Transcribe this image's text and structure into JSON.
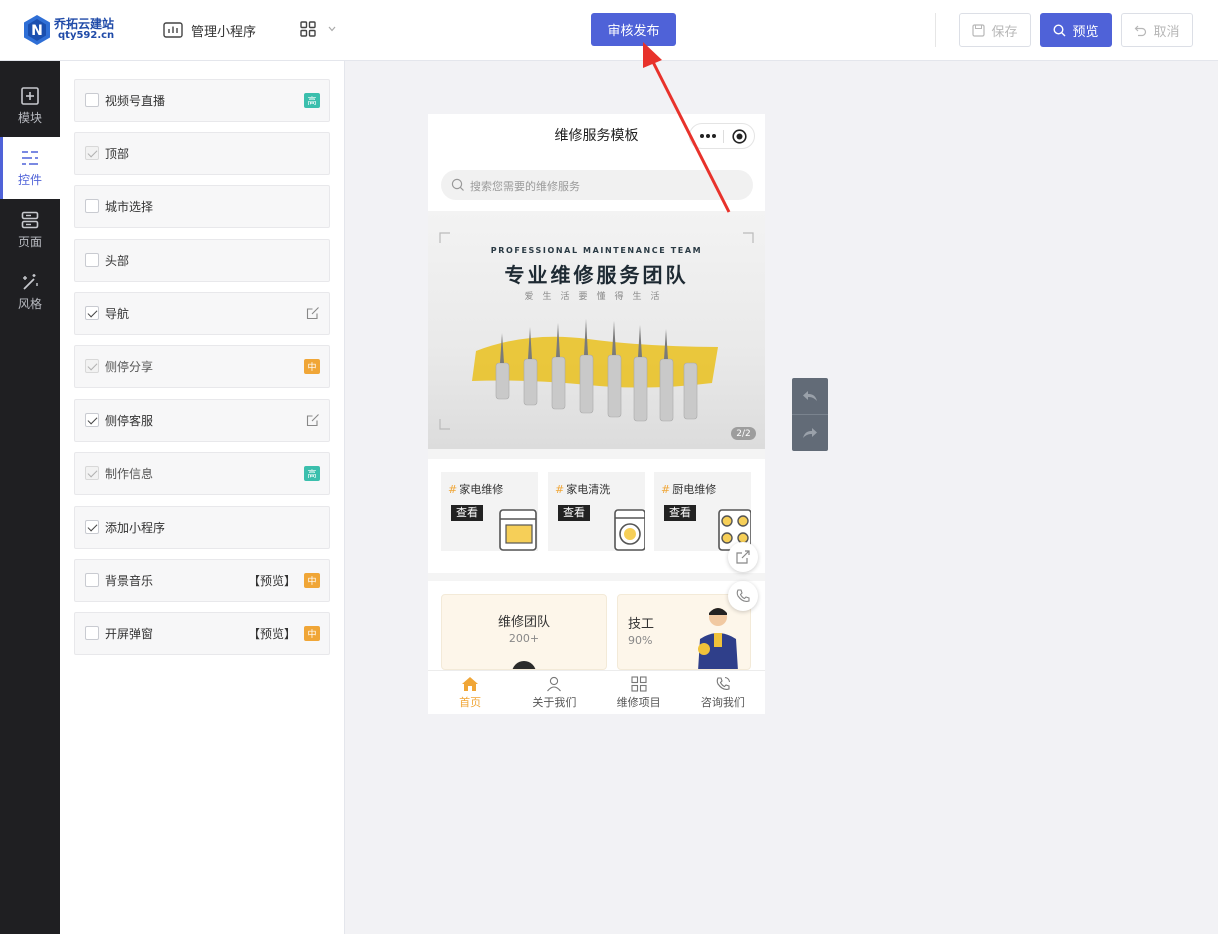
{
  "header": {
    "logo_name": "乔拓云建站",
    "logo_url": "qty592.cn",
    "manage_label": "管理小程序",
    "publish_label": "审核发布",
    "save_label": "保存",
    "preview_label": "预览",
    "cancel_label": "取消"
  },
  "leftnav": {
    "items": [
      {
        "label": "模块",
        "icon": "plus-square-icon"
      },
      {
        "label": "控件",
        "icon": "sliders-icon"
      },
      {
        "label": "页面",
        "icon": "server-icon"
      },
      {
        "label": "风格",
        "icon": "magic-wand-icon"
      }
    ],
    "active_index": 1
  },
  "controls": [
    {
      "label": "视频号直播",
      "checked": false,
      "disabled": false,
      "tag": "高"
    },
    {
      "label": "顶部",
      "checked": true,
      "disabled": true
    },
    {
      "label": "城市选择",
      "checked": false,
      "disabled": false
    },
    {
      "label": "头部",
      "checked": false,
      "disabled": false
    },
    {
      "label": "导航",
      "checked": true,
      "disabled": false,
      "editable": true
    },
    {
      "label": "侧停分享",
      "checked": true,
      "disabled": true,
      "tag": "中"
    },
    {
      "label": "侧停客服",
      "checked": true,
      "disabled": false,
      "editable": true
    },
    {
      "label": "制作信息",
      "checked": true,
      "disabled": true,
      "tag": "高"
    },
    {
      "label": "添加小程序",
      "checked": true,
      "disabled": false
    },
    {
      "label": "背景音乐",
      "checked": false,
      "disabled": false,
      "preview": "【预览】",
      "tag": "中"
    },
    {
      "label": "开屏弹窗",
      "checked": false,
      "disabled": false,
      "preview": "【预览】",
      "tag": "中"
    }
  ],
  "phone": {
    "title": "维修服务模板",
    "search_placeholder": "搜索您需要的维修服务",
    "banner": {
      "en_title": "PROFESSIONAL MAINTENANCE TEAM",
      "zh_title": "专业维修服务团队",
      "subtitle": "爱生活要懂得生活",
      "page_indicator": "2/2"
    },
    "categories": [
      {
        "name": "家电维修",
        "button": "查看"
      },
      {
        "name": "家电清洗",
        "button": "查看"
      },
      {
        "name": "厨电维修",
        "button": "查看"
      }
    ],
    "features": [
      {
        "title": "维修团队",
        "value": "200+"
      },
      {
        "title": "技工",
        "value": "90%"
      }
    ],
    "tabs": [
      {
        "label": "首页"
      },
      {
        "label": "关于我们"
      },
      {
        "label": "维修项目"
      },
      {
        "label": "咨询我们"
      }
    ]
  },
  "colors": {
    "accent": "#4f62d8",
    "nav_bg": "#1f1f22",
    "tag_high": "#3bbfad",
    "tag_mid": "#f0a637",
    "annotation_arrow": "#e8322b"
  }
}
